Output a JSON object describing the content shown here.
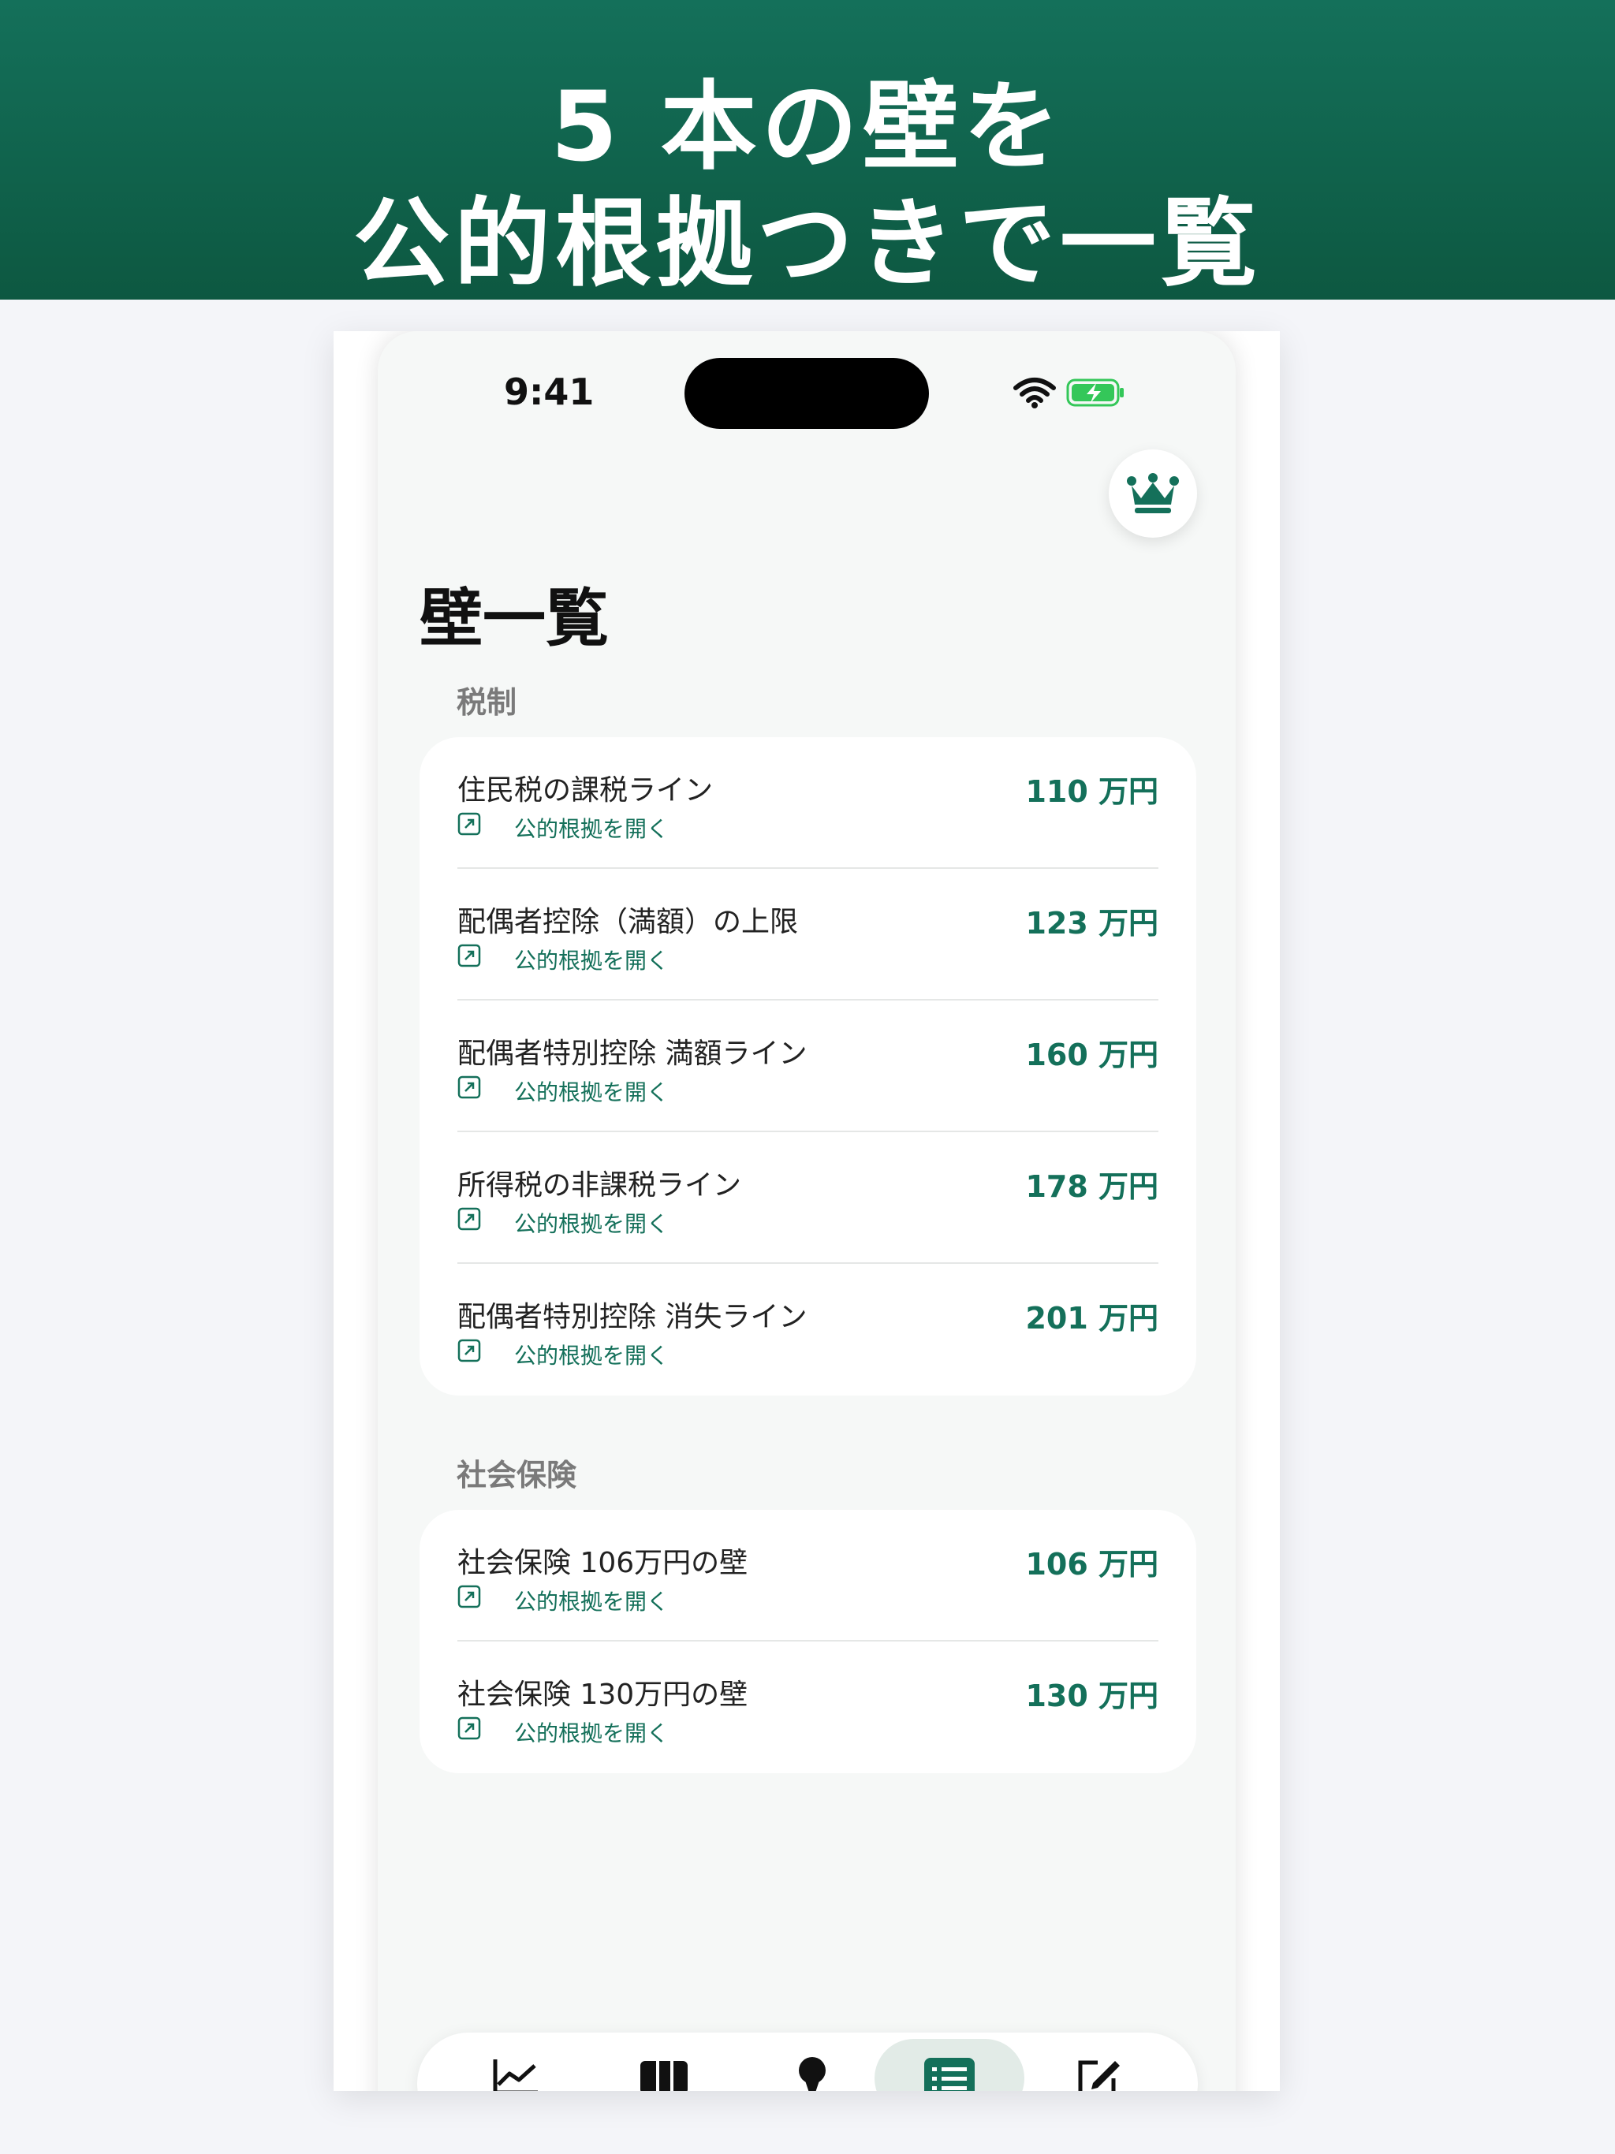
{
  "banner": {
    "line1": "5 本の壁を",
    "line2": "公的根拠つきで一覧"
  },
  "status_bar": {
    "time": "9:41"
  },
  "header": {
    "title": "壁一覧",
    "premium_icon": "crown-icon"
  },
  "sections": [
    {
      "title": "税制",
      "items": [
        {
          "title": "住民税の課税ライン",
          "amount": "110 万円",
          "link": "公的根拠を開く"
        },
        {
          "title": "配偶者控除（満額）の上限",
          "amount": "123 万円",
          "link": "公的根拠を開く"
        },
        {
          "title": "配偶者特別控除 満額ライン",
          "amount": "160 万円",
          "link": "公的根拠を開く"
        },
        {
          "title": "所得税の非課税ライン",
          "amount": "178 万円",
          "link": "公的根拠を開く"
        },
        {
          "title": "配偶者特別控除 消失ライン",
          "amount": "201 万円",
          "link": "公的根拠を開く"
        }
      ]
    },
    {
      "title": "社会保険",
      "items": [
        {
          "title": "社会保険 106万円の壁",
          "amount": "106 万円",
          "link": "公的根拠を開く"
        },
        {
          "title": "社会保険 130万円の壁",
          "amount": "130 万円",
          "link": "公的根拠を開く"
        }
      ]
    }
  ],
  "tab_bar": {
    "tabs": [
      {
        "icon": "chart-line-icon",
        "active": false
      },
      {
        "icon": "columns-icon",
        "active": false
      },
      {
        "icon": "pin-icon",
        "active": false
      },
      {
        "icon": "list-icon",
        "active": true
      },
      {
        "icon": "edit-icon",
        "active": false
      }
    ]
  },
  "colors": {
    "accent": "#14705a",
    "banner": "#0f6049",
    "battery": "#34c759"
  }
}
